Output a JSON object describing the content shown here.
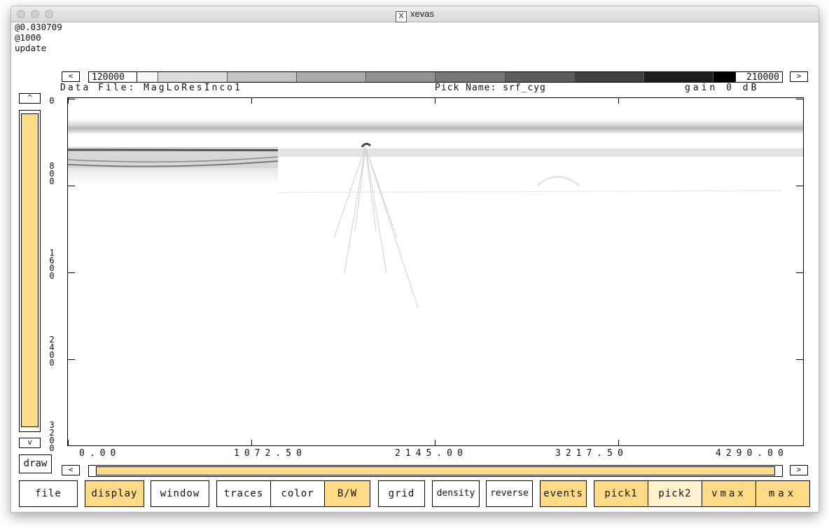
{
  "window": {
    "title": "xevas",
    "title_icon": "X"
  },
  "status": {
    "line1": "@0.030709",
    "line2": "@1000",
    "line3": "update"
  },
  "colorbar": {
    "min_label": "120000",
    "max_label": "210000",
    "left_arrow": "<",
    "right_arrow": ">",
    "colors": [
      "#f6f6f6",
      "#dcdcdc",
      "#c4c4c4",
      "#aaaaaa",
      "#929292",
      "#777777",
      "#5c5c5c",
      "#3f3f3f",
      "#1e1e1e",
      "#000000"
    ]
  },
  "info": {
    "data_file": "Data File: MagLoResInco1",
    "pick_name": "Pick Name: srf_cyg",
    "gain": "gain  0  dB"
  },
  "yticks": [
    {
      "label": [
        "0"
      ]
    },
    {
      "label": [
        "8",
        "0",
        "0"
      ]
    },
    {
      "label": [
        "1",
        "6",
        "0",
        "0"
      ]
    },
    {
      "label": [
        "2",
        "4",
        "0",
        "0"
      ]
    },
    {
      "label": [
        "3",
        "2",
        "0",
        "0"
      ]
    }
  ],
  "xticks": [
    {
      "label": "0.00"
    },
    {
      "label": "1072.50"
    },
    {
      "label": "2145.00"
    },
    {
      "label": "3217.50"
    },
    {
      "label": "4290.00"
    }
  ],
  "vslider": {
    "down_arrow": "v",
    "up_arrow": "^"
  },
  "hslider": {
    "left_arrow": "<",
    "right_arrow": ">"
  },
  "draw_button": "draw",
  "buttons": {
    "file": "file",
    "display": "display",
    "window": "window",
    "traces": "traces",
    "color": "color",
    "bw": "B/W",
    "grid": "grid",
    "density": "density",
    "reverse": "reverse",
    "events": "events",
    "pick1": "pick1",
    "pick2": "pick2",
    "vmax": "vmax",
    "max": "max"
  },
  "accent_color": "#fedb84"
}
